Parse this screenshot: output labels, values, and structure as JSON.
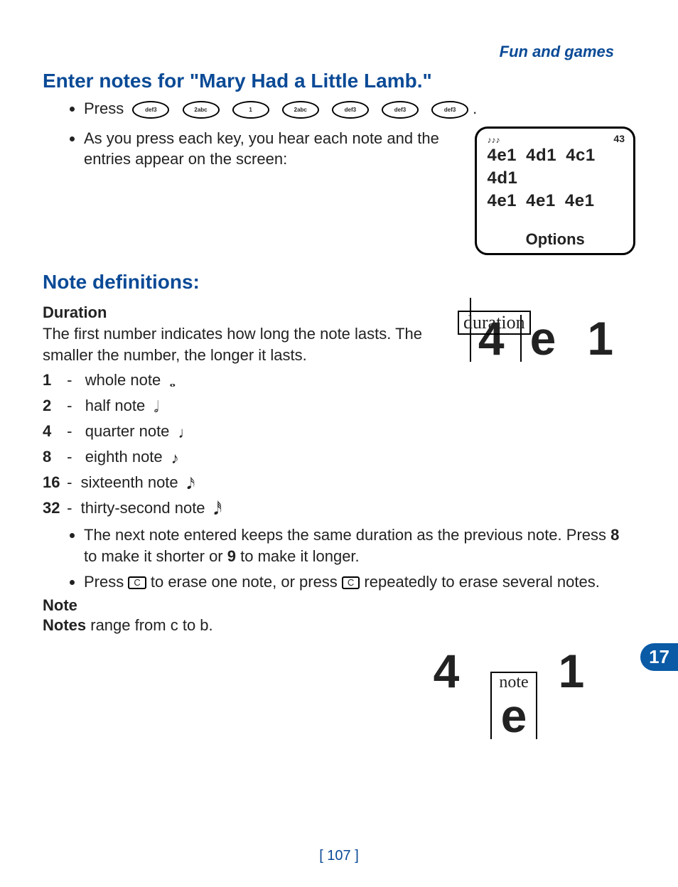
{
  "header": {
    "section_label": "Fun and games"
  },
  "section1": {
    "title": "Enter notes for \"Mary Had a Little Lamb.\"",
    "press_label": "Press",
    "keys": [
      "def3",
      "2abc",
      "1",
      "2abc",
      "def3",
      "def3",
      "def3"
    ],
    "period": ".",
    "step2": "As you press each key, you hear each note and the entries appear on the screen:"
  },
  "screen": {
    "icon_hint": "♪♪♪",
    "count": "43",
    "line1": "4e1 4d1 4c1 4d1",
    "line2": "4e1 4e1 4e1",
    "options_label": "Options"
  },
  "section2": {
    "title": "Note definitions:",
    "duration_heading": "Duration",
    "duration_body": "The first number indicates how long the note lasts. The smaller the number, the longer it lasts.",
    "defs": [
      {
        "n": "1",
        "label": "whole note",
        "glyph": "𝅝"
      },
      {
        "n": "2",
        "label": "half note",
        "glyph": "𝅗𝅥"
      },
      {
        "n": "4",
        "label": "quarter note",
        "glyph": "♩"
      },
      {
        "n": "8",
        "label": "eighth note",
        "glyph": "♪"
      },
      {
        "n": "16",
        "label": "sixteenth note",
        "glyph": "𝅘𝅥𝅯"
      },
      {
        "n": "32",
        "label": "thirty-second note",
        "glyph": "𝅘𝅥𝅰"
      }
    ],
    "tip1_pre": "The next note entered keeps the same duration as the previous note. Press ",
    "tip1_key1": "8",
    "tip1_mid": " to make it shorter or ",
    "tip1_key2": "9",
    "tip1_end": " to make it longer.",
    "tip2_pre": "Press ",
    "tip2_mid": " to erase one note, or press ",
    "tip2_end": " repeatedly to erase several notes.",
    "c_key_label": "C",
    "note_heading": "Note",
    "note_body_strong": "Notes",
    "note_body_rest": " range from c to b."
  },
  "diagram_duration": {
    "label": "duration",
    "d1": "4",
    "d2": "e",
    "d3": "1"
  },
  "diagram_note": {
    "label": "note",
    "d1": "4",
    "d2": "e",
    "d3": "1"
  },
  "chapter": {
    "number": "17"
  },
  "page": {
    "number": "[ 107 ]"
  }
}
